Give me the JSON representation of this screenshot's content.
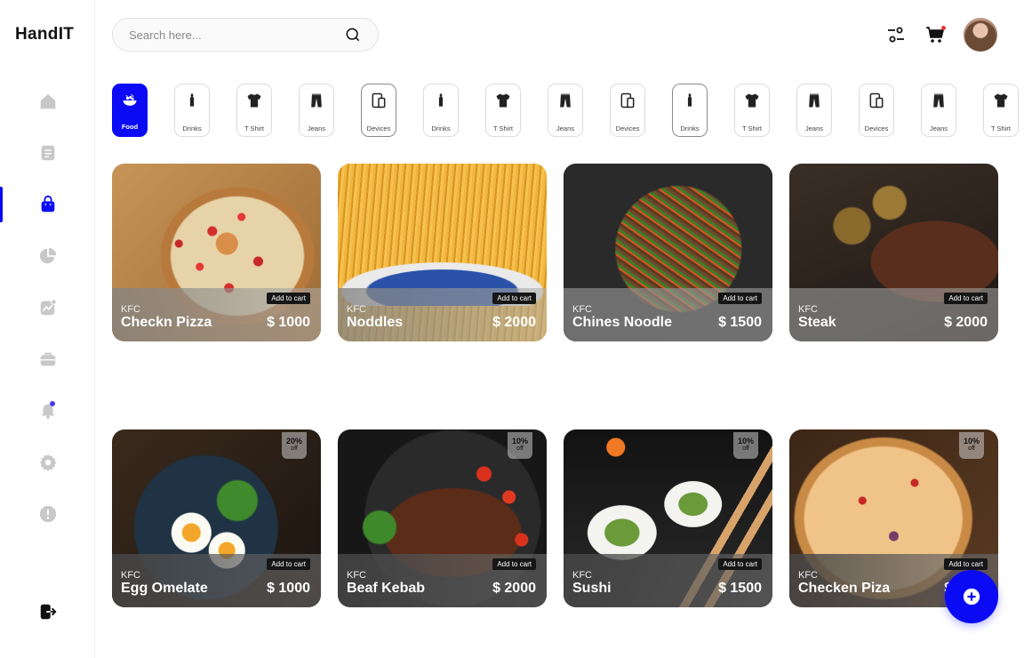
{
  "app": {
    "logo": "HandIT"
  },
  "sidebar": {
    "items": [
      {
        "name": "home",
        "icon": "home-icon",
        "active": false
      },
      {
        "name": "orders",
        "icon": "document-icon",
        "active": false
      },
      {
        "name": "shop",
        "icon": "shopping-bag-icon",
        "active": true
      },
      {
        "name": "analytics",
        "icon": "pie-chart-icon",
        "active": false
      },
      {
        "name": "trends",
        "icon": "trend-chart-icon",
        "active": false
      },
      {
        "name": "jobs",
        "icon": "briefcase-icon",
        "active": false
      },
      {
        "name": "notifications",
        "icon": "bell-icon",
        "active": false
      },
      {
        "name": "settings",
        "icon": "gear-icon",
        "active": false
      },
      {
        "name": "info",
        "icon": "alert-circle-icon",
        "active": false
      }
    ],
    "logout_icon": "logout-icon"
  },
  "header": {
    "search_placeholder": "Search here...",
    "icons": [
      "filter-icon",
      "cart-icon"
    ]
  },
  "categories": [
    {
      "label": "Food",
      "icon": "food-bowl-icon",
      "active": true
    },
    {
      "label": "Drinks",
      "icon": "bottle-icon"
    },
    {
      "label": "T Shirt",
      "icon": "tshirt-icon"
    },
    {
      "label": "Jeans",
      "icon": "jeans-icon"
    },
    {
      "label": "Devices",
      "icon": "devices-icon"
    },
    {
      "label": "Drinks",
      "icon": "bottle-icon"
    },
    {
      "label": "T Shirt",
      "icon": "tshirt-icon"
    },
    {
      "label": "Jeans",
      "icon": "jeans-icon"
    },
    {
      "label": "Devices",
      "icon": "devices-icon"
    },
    {
      "label": "Drinks",
      "icon": "bottle-icon"
    },
    {
      "label": "T Shirt",
      "icon": "tshirt-icon"
    },
    {
      "label": "Jeans",
      "icon": "jeans-icon"
    },
    {
      "label": "Devices",
      "icon": "devices-icon"
    },
    {
      "label": "Jeans",
      "icon": "jeans-icon"
    },
    {
      "label": "T Shirt",
      "icon": "tshirt-icon"
    }
  ],
  "products": [
    {
      "brand": "KFC",
      "name": "Checkn Pizza",
      "price": "$ 1000",
      "cart_label": "Add to cart",
      "discount": null
    },
    {
      "brand": "KFC",
      "name": "Noddles",
      "price": "$ 2000",
      "cart_label": "Add to cart",
      "discount": null
    },
    {
      "brand": "KFC",
      "name": "Chines Noodle",
      "price": "$ 1500",
      "cart_label": "Add to cart",
      "discount": null
    },
    {
      "brand": "KFC",
      "name": "Steak",
      "price": "$ 2000",
      "cart_label": "Add to cart",
      "discount": null
    },
    {
      "brand": "KFC",
      "name": "Egg Omelate",
      "price": "$ 1000",
      "cart_label": "Add to cart",
      "discount": "20%",
      "discount_suffix": "off"
    },
    {
      "brand": "KFC",
      "name": "Beaf Kebab",
      "price": "$ 2000",
      "cart_label": "Add to cart",
      "discount": "10%",
      "discount_suffix": "off"
    },
    {
      "brand": "KFC",
      "name": "Sushi",
      "price": "$ 1500",
      "cart_label": "Add to cart",
      "discount": "10%",
      "discount_suffix": "off"
    },
    {
      "brand": "KFC",
      "name": "Checken Piza",
      "price": "$ 2000",
      "cart_label": "Add to cart",
      "discount": "10%",
      "discount_suffix": "off"
    }
  ],
  "fab": {
    "icon": "plus-circle-icon"
  },
  "colors": {
    "accent": "#0a0af5",
    "notification_dot": "#4b3cf5",
    "cart_dot": "#e53935"
  }
}
